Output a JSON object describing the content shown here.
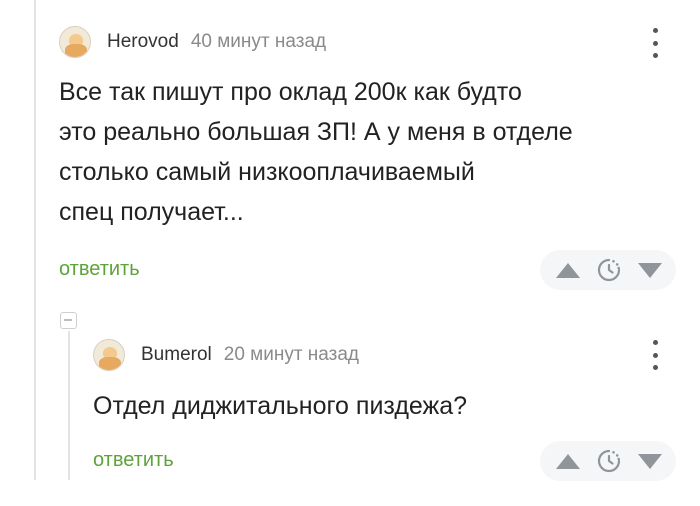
{
  "comments": [
    {
      "username": "Herovod",
      "time": "40 минут назад",
      "text_lines": [
        "Все так пишут про оклад 200к как будто",
        "это реально большая ЗП! А у меня в отделе",
        "столько самый низкооплачиваемый",
        "спец получает..."
      ],
      "reply_label": "ответить",
      "avatar_icon": "user-avatar-icon",
      "more_icon": "more-vertical-icon"
    },
    {
      "username": "Bumerol",
      "time": "20 минут назад",
      "text_lines": [
        "Отдел диджитального пиздежа?"
      ],
      "reply_label": "ответить",
      "avatar_icon": "user-avatar-icon",
      "more_icon": "more-vertical-icon"
    }
  ],
  "rating_icons": {
    "up": "upvote-arrow-icon",
    "pending": "clock-rating-pending-icon",
    "down": "downvote-arrow-icon"
  },
  "colors": {
    "reply_link": "#5ea33a",
    "rating_bg": "#f4f6f8",
    "icon_gray": "#8f959b",
    "time_gray": "#8a8a8a",
    "thread_line": "#e3e3e3"
  }
}
